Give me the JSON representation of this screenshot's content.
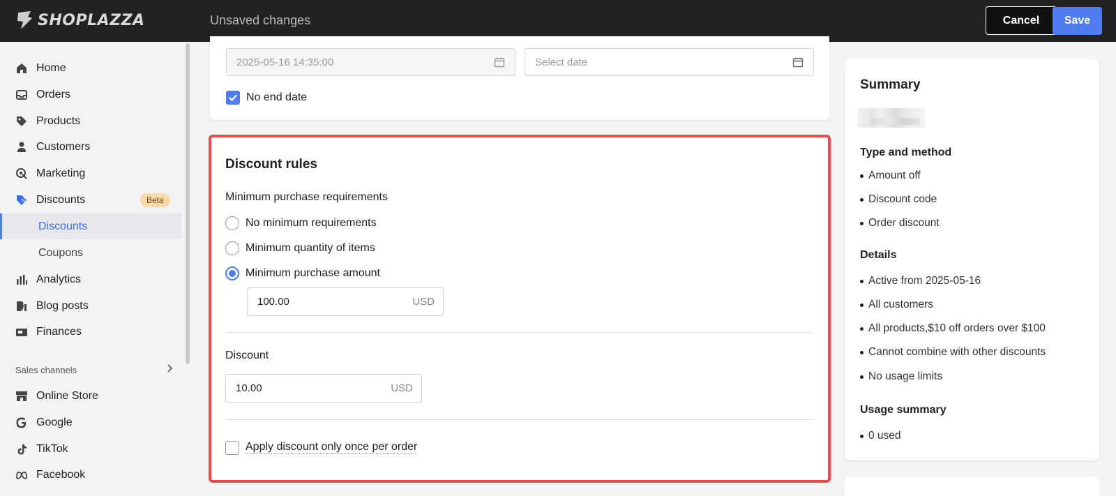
{
  "topbar": {
    "logo_text": "SHOPLAZZA",
    "status": "Unsaved changes",
    "cancel_label": "Cancel",
    "save_label": "Save"
  },
  "sidebar": {
    "items": [
      {
        "label": "Home",
        "icon": "home-icon"
      },
      {
        "label": "Orders",
        "icon": "inbox-icon"
      },
      {
        "label": "Products",
        "icon": "tag-icon"
      },
      {
        "label": "Customers",
        "icon": "person-icon"
      },
      {
        "label": "Marketing",
        "icon": "target-icon"
      },
      {
        "label": "Discounts",
        "icon": "discount-tag-icon",
        "badge": "Beta"
      },
      {
        "label": "Discounts",
        "sub": true,
        "active": true
      },
      {
        "label": "Coupons",
        "sub": true
      },
      {
        "label": "Analytics",
        "icon": "bar-chart-icon"
      },
      {
        "label": "Blog posts",
        "icon": "blog-icon"
      },
      {
        "label": "Finances",
        "icon": "finance-icon"
      }
    ],
    "section_label": "Sales channels",
    "channels": [
      {
        "label": "Online Store",
        "icon": "store-icon"
      },
      {
        "label": "Google",
        "icon": "google-icon"
      },
      {
        "label": "TikTok",
        "icon": "tiktok-icon"
      },
      {
        "label": "Facebook",
        "icon": "meta-icon"
      }
    ]
  },
  "dates": {
    "start_value": "2025-05-16 14:35:00",
    "end_placeholder": "Select date",
    "no_end_date_label": "No end date",
    "no_end_date_checked": true
  },
  "rules": {
    "title": "Discount rules",
    "min_req_label": "Minimum purchase requirements",
    "options": [
      {
        "label": "No minimum requirements",
        "selected": false
      },
      {
        "label": "Minimum quantity of items",
        "selected": false
      },
      {
        "label": "Minimum purchase amount",
        "selected": true
      }
    ],
    "min_amount_value": "100.00",
    "currency": "USD",
    "discount_label": "Discount",
    "discount_value": "10.00",
    "apply_once_label": "Apply discount only once per order",
    "apply_once_checked": false
  },
  "summary": {
    "title": "Summary",
    "type_heading": "Type and method",
    "type_items": [
      "Amount off",
      "Discount code",
      "Order discount"
    ],
    "details_heading": "Details",
    "details_items": [
      "Active from 2025-05-16",
      "All customers",
      "All products,$10 off orders over $100",
      "Cannot combine with other discounts",
      "No usage limits"
    ],
    "usage_heading": "Usage summary",
    "usage_items": [
      "0 used"
    ]
  },
  "colors": {
    "accent": "#4f7df0",
    "highlight_border": "#ea4a4a",
    "topbar_bg": "#222222",
    "badge_bg": "#fcd9a8"
  }
}
